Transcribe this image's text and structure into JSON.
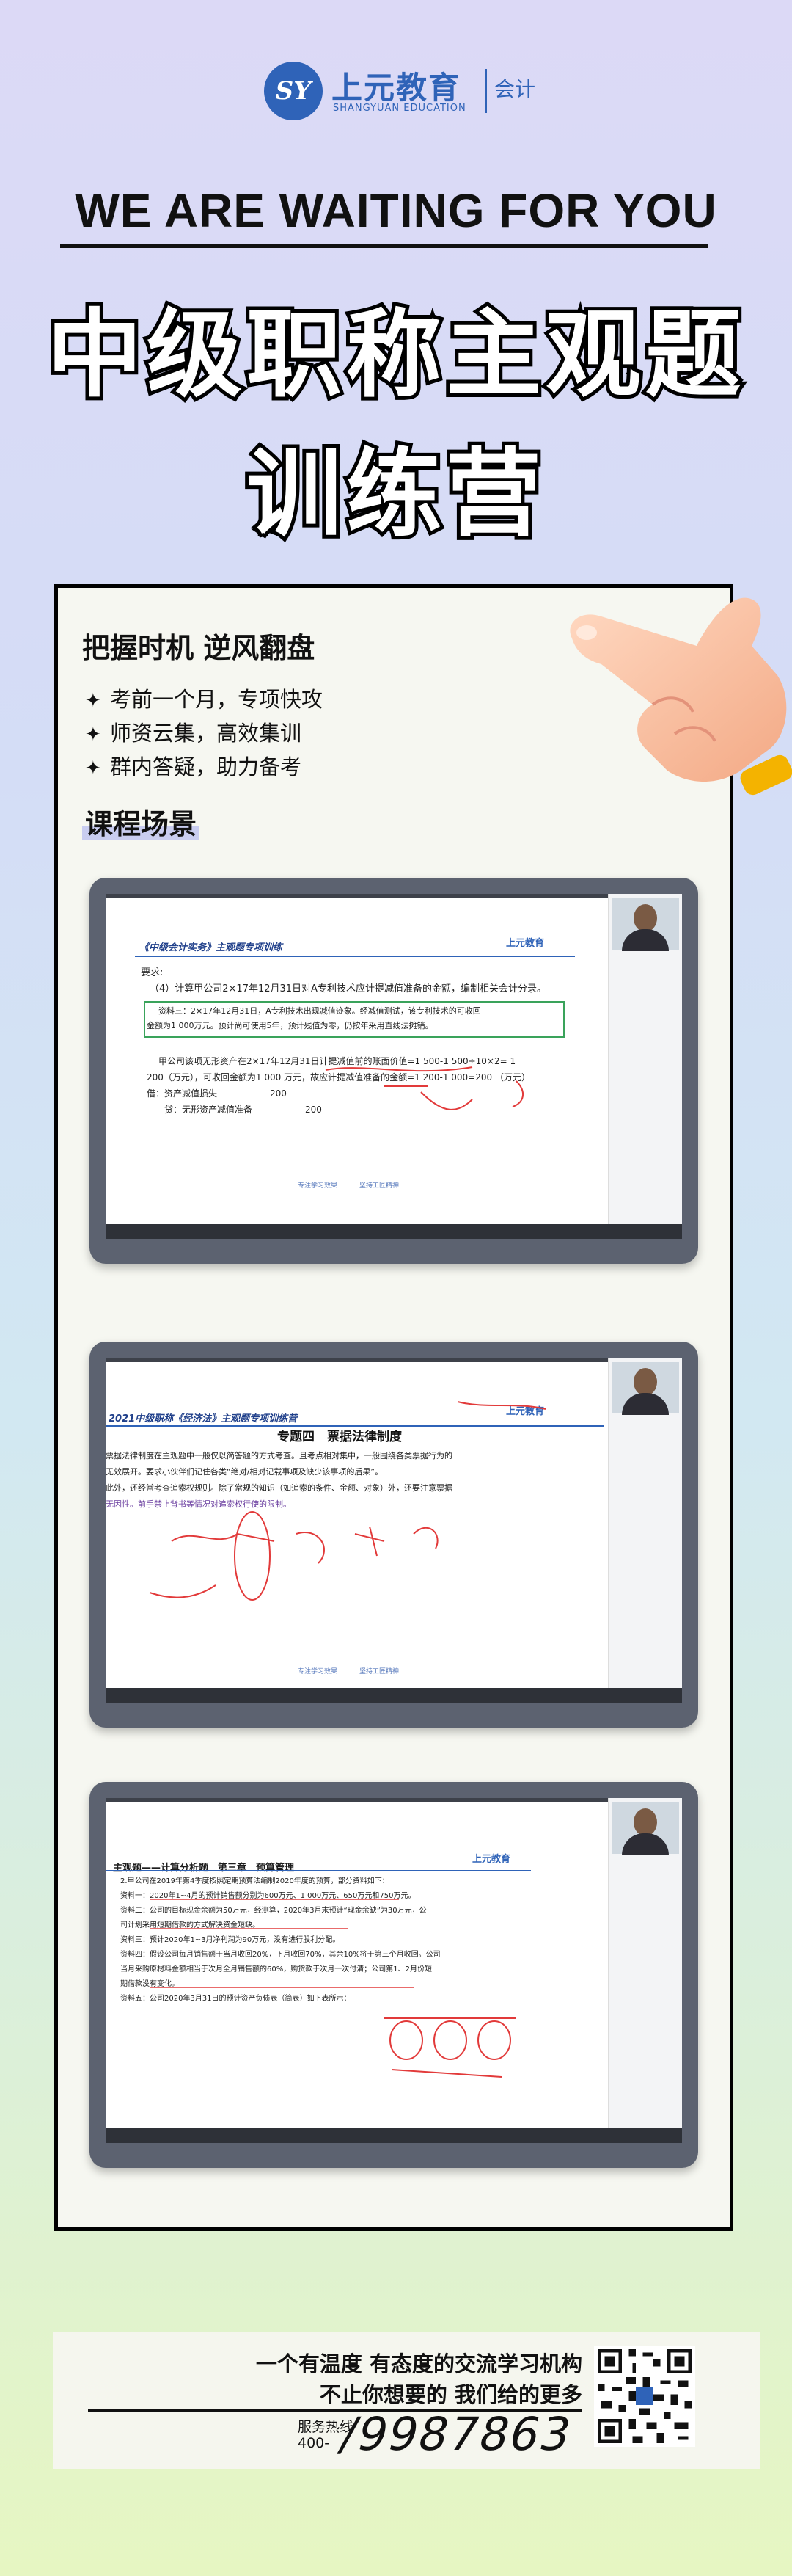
{
  "brand": {
    "logo_mark": "SY",
    "name_cn": "上元教育",
    "name_en": "SHANGYUAN EDUCATION",
    "division": "会计",
    "color": "#2f63b8"
  },
  "tagline": "WE ARE WAITING FOR YOU",
  "headline": [
    "中级职称主观题",
    "训练营"
  ],
  "panel": {
    "section1_title": "把握时机 逆风翻盘",
    "bullets": [
      "考前一个月，专项快攻",
      "师资云集，高效集训",
      "群内答疑，助力备考"
    ],
    "section2_title": "课程场景"
  },
  "screens": [
    {
      "title": "《中级会计实务》主观题专项训练",
      "logo": "上元教育",
      "lines": [
        "要求:",
        "（4）计算甲公司2×17年12月31日对A专利技术应计提减值准备的金额，编制相关会计分录。",
        "资料三：2×17年12月31日，A专利技术出现减值迹象。经减值测试，该专利技术的可收回",
        "金额为1 000万元。预计尚可使用5年，预计残值为零，仍按年采用直线法摊销。",
        "甲公司该项无形资产在2×17年12月31日计提减值前的账面价值=1 500-1 500÷10×2= 1",
        "200（万元），可收回金额为1 000 万元，故应计提减值准备的金额=1 200-1 000=200 （万元）",
        "借：资产减值损失　　　　　　200",
        "　　贷：无形资产减值准备　　　　　　200"
      ],
      "footer": [
        "专注学习效果",
        "坚持工匠精神"
      ]
    },
    {
      "title": "2021中级职称《经济法》主观题专项训练营",
      "logo": "上元教育",
      "heading": "专题四　票据法律制度",
      "lines": [
        "票据法律制度在主观题中一般仅以简答题的方式考查。且考点相对集中，一般围绕各类票据行为的",
        "无效展开。要求小伙伴们记住各类“绝对/相对记载事项及缺少该事项的后果”。",
        "此外，还经常考查追索权规则。除了常规的知识（如追索的条件、金额、对象）外，还要注意票据",
        "无因性。前手禁止背书等情况对追索权行使的限制。"
      ],
      "footer": [
        "专注学习效果",
        "坚持工匠精神"
      ]
    },
    {
      "title": "主观题——计算分析题　第三章　预算管理",
      "logo": "上元教育",
      "lines": [
        "2.甲公司在2019年第4季度按照定期预算法编制2020年度的预算，部分资料如下：",
        "资料一：2020年1~4月的预计销售额分别为600万元、1 000万元、650万元和750万元。",
        "资料二：公司的目标现金余额为50万元，经测算，2020年3月末预计“现金余缺”为30万元，公",
        "司计划采用短期借款的方式解决资金短缺。",
        "资料三：预计2020年1~3月净利润为90万元，没有进行股利分配。",
        "资料四：假设公司每月销售额于当月收回20%，下月收回70%，其余10%将于第三个月收回。公司",
        "当月采购原材料金额相当于次月全月销售额的60%，购货款于次月一次付清；公司第1、2月份短",
        "期借款没有变化。",
        "资料五：公司2020年3月31日的预计资产负债表（简表）如下表所示："
      ]
    }
  ],
  "footer": {
    "slogan_1": "一个有温度 有态度的交流学习机构",
    "slogan_2": "不止你想要的 我们给的更多",
    "hotline_label": "服务热线",
    "hotline_prefix": "400-",
    "hotline_number": "/9987863"
  }
}
